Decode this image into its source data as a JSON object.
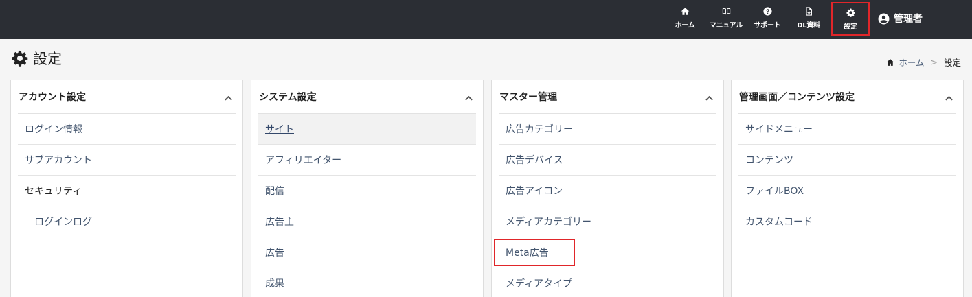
{
  "nav": {
    "home": "ホーム",
    "manual": "マニュアル",
    "support": "サポート",
    "dl": "DL資料",
    "settings": "設定",
    "user": "管理者"
  },
  "page": {
    "title": "設定",
    "breadcrumb": {
      "home": "ホーム",
      "separator": ">",
      "current": "設定"
    }
  },
  "panels": [
    {
      "title": "アカウント設定",
      "items": [
        {
          "label": "ログイン情報"
        },
        {
          "label": "サブアカウント"
        },
        {
          "label": "セキュリティ"
        },
        {
          "label": "ログインログ"
        }
      ]
    },
    {
      "title": "システム設定",
      "items": [
        {
          "label": "サイト"
        },
        {
          "label": "アフィリエイター"
        },
        {
          "label": "配信"
        },
        {
          "label": "広告主"
        },
        {
          "label": "広告"
        },
        {
          "label": "成果"
        }
      ]
    },
    {
      "title": "マスター管理",
      "items": [
        {
          "label": "広告カテゴリー"
        },
        {
          "label": "広告デバイス"
        },
        {
          "label": "広告アイコン"
        },
        {
          "label": "メディアカテゴリー"
        },
        {
          "label": "Meta広告"
        },
        {
          "label": "メディアタイプ"
        }
      ]
    },
    {
      "title": "管理画面／コンテンツ設定",
      "items": [
        {
          "label": "サイドメニュー"
        },
        {
          "label": "コンテンツ"
        },
        {
          "label": "ファイルBOX"
        },
        {
          "label": "カスタムコード"
        }
      ]
    }
  ],
  "colors": {
    "topbar": "#2b2e34",
    "highlight": "#e0262a",
    "link": "#43556e"
  }
}
